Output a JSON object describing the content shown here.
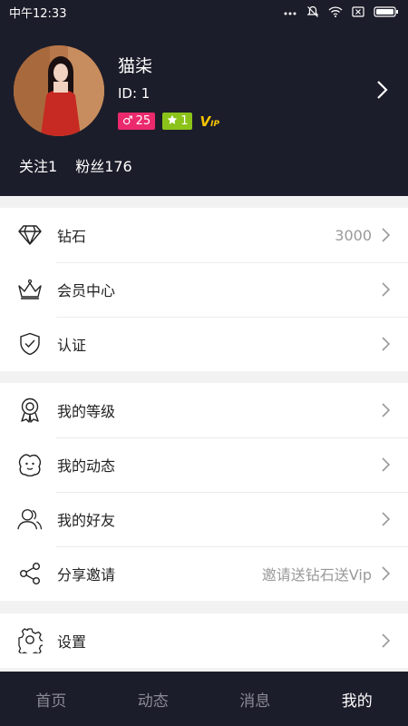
{
  "status": {
    "time": "中午12:33"
  },
  "profile": {
    "name": "猫柒",
    "id_text": "ID: 1",
    "gender_symbol": "♂",
    "age": "25",
    "level": "1",
    "vip_main": "V",
    "vip_sub": "IP",
    "following": "关注1",
    "fans": "粉丝176"
  },
  "menu_group1": [
    {
      "label": "钻石",
      "value": "3000",
      "icon": "diamond-icon"
    },
    {
      "label": "会员中心",
      "value": "",
      "icon": "crown-icon"
    },
    {
      "label": "认证",
      "value": "",
      "icon": "shield-check-icon"
    }
  ],
  "menu_group2": [
    {
      "label": "我的等级",
      "value": "",
      "icon": "medal-icon"
    },
    {
      "label": "我的动态",
      "value": "",
      "icon": "face-icon"
    },
    {
      "label": "我的好友",
      "value": "",
      "icon": "friends-icon"
    },
    {
      "label": "分享邀请",
      "value": "邀请送钻石送Vip",
      "icon": "share-icon"
    }
  ],
  "menu_group3": [
    {
      "label": "设置",
      "value": "",
      "icon": "gear-icon"
    }
  ],
  "tabs": [
    {
      "label": "首页",
      "active": false
    },
    {
      "label": "动态",
      "active": false
    },
    {
      "label": "消息",
      "active": false
    },
    {
      "label": "我的",
      "active": true
    }
  ],
  "colors": {
    "header_bg": "#1c1d2a",
    "gender_badge": "#ea2a6c",
    "level_badge": "#8bc31a",
    "vip": "#f5c400"
  }
}
